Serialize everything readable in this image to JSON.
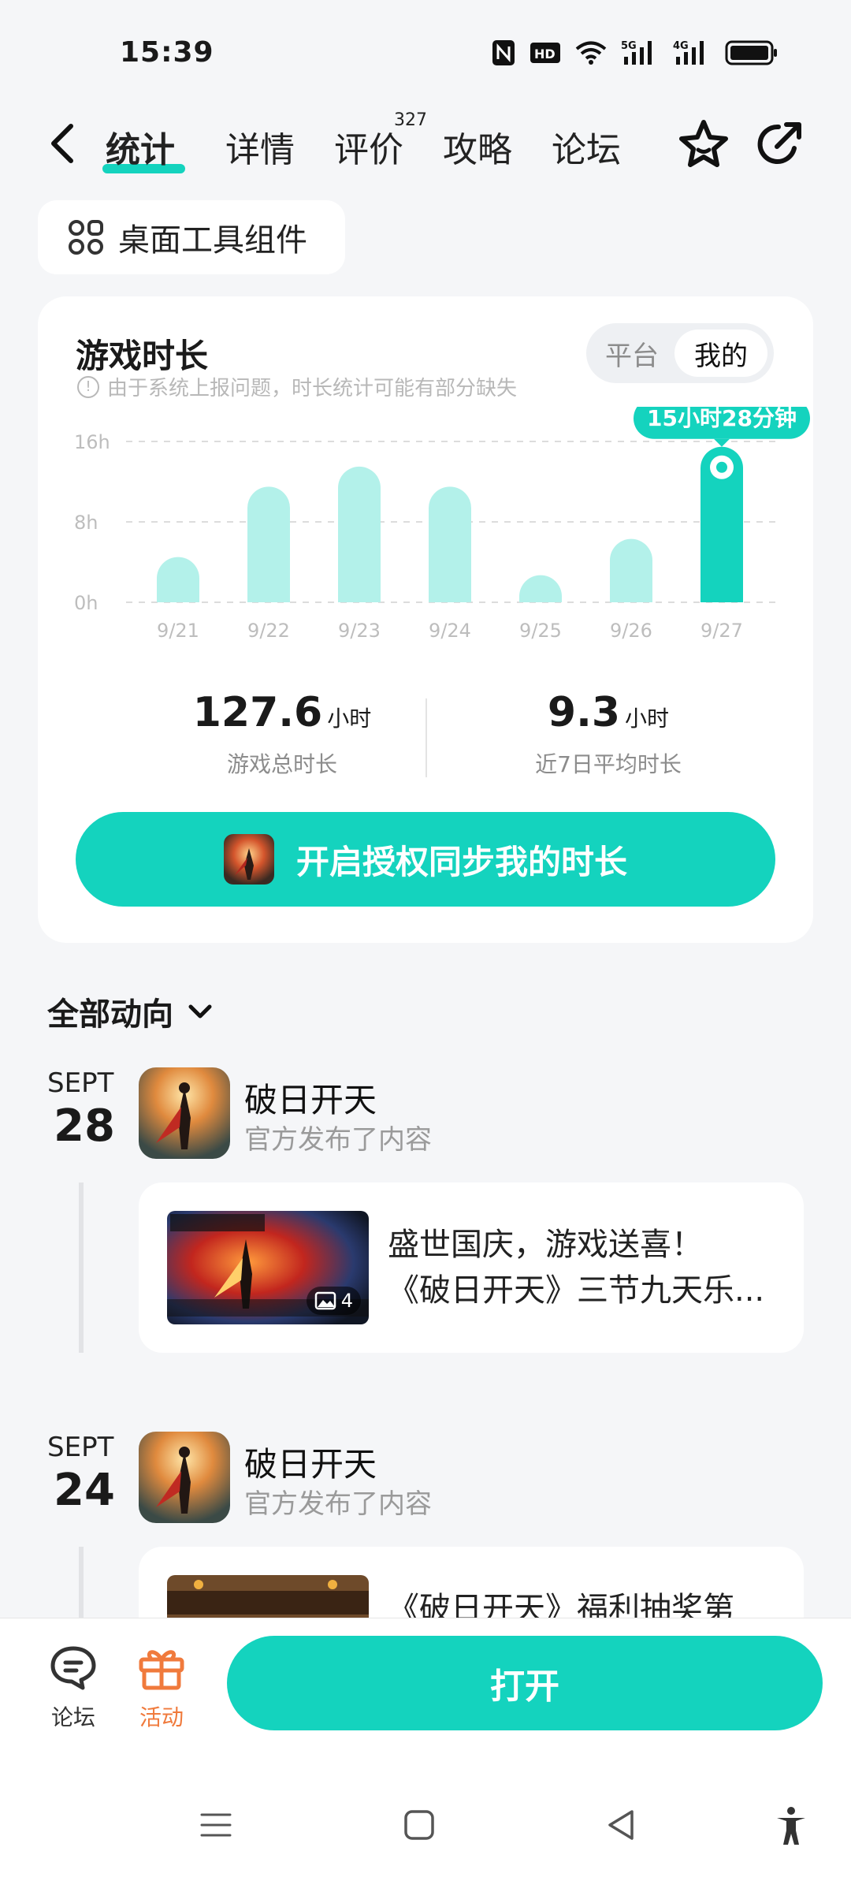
{
  "status_bar": {
    "time": "15:39",
    "icons": [
      "nfc-icon",
      "hd-voice-icon",
      "wifi-icon",
      "5g-signal-icon",
      "4g-signal-icon",
      "battery-icon"
    ],
    "hd_label": "HD",
    "net1": "5G",
    "net2": "4G"
  },
  "header": {
    "tabs": [
      {
        "label": "统计",
        "active": true
      },
      {
        "label": "详情"
      },
      {
        "label": "评价",
        "badge": "327"
      },
      {
        "label": "攻略"
      },
      {
        "label": "论坛"
      }
    ]
  },
  "widget": {
    "label": "桌面工具组件"
  },
  "playtime": {
    "title": "游戏时长",
    "note": "由于系统上报问题，时长统计可能有部分缺失",
    "toggle": [
      "平台",
      "我的"
    ],
    "total_value": "127.6",
    "total_unit": "小时",
    "total_label": "游戏总时长",
    "avg_value": "9.3",
    "avg_unit": "小时",
    "avg_label": "近7日平均时长",
    "sync_label": "开启授权同步我的时长"
  },
  "chart_data": {
    "type": "bar",
    "categories": [
      "9/21",
      "9/22",
      "9/23",
      "9/24",
      "9/25",
      "9/26",
      "9/27"
    ],
    "values": [
      4.5,
      11.5,
      13.5,
      11.5,
      2.7,
      6.3,
      15.47
    ],
    "y_ticks": [
      "16h",
      "8h",
      "0h"
    ],
    "ylim": [
      0,
      16
    ],
    "highlight_index": 6,
    "highlight_label": "15小时28分钟",
    "color_bar": "#b3f1ea",
    "color_highlight": "#14d3be",
    "grid": true
  },
  "feed": {
    "title": "全部动向",
    "posts": [
      {
        "month": "SEPT",
        "day": "28",
        "name": "破日开天",
        "sub": "官方发布了内容",
        "line1": "盛世国庆，游戏送喜！",
        "line2": "《破日开天》三节九天乐...",
        "img_count": "4"
      },
      {
        "month": "SEPT",
        "day": "24",
        "name": "破日开天",
        "sub": "官方发布了内容",
        "line1": "《破日开天》福利抽奖第",
        "line2": ""
      }
    ]
  },
  "bottom": {
    "forum_label": "论坛",
    "activity_label": "活动",
    "open_label": "打开",
    "accent": "#14d3be",
    "activity_color": "#f07a3c"
  }
}
